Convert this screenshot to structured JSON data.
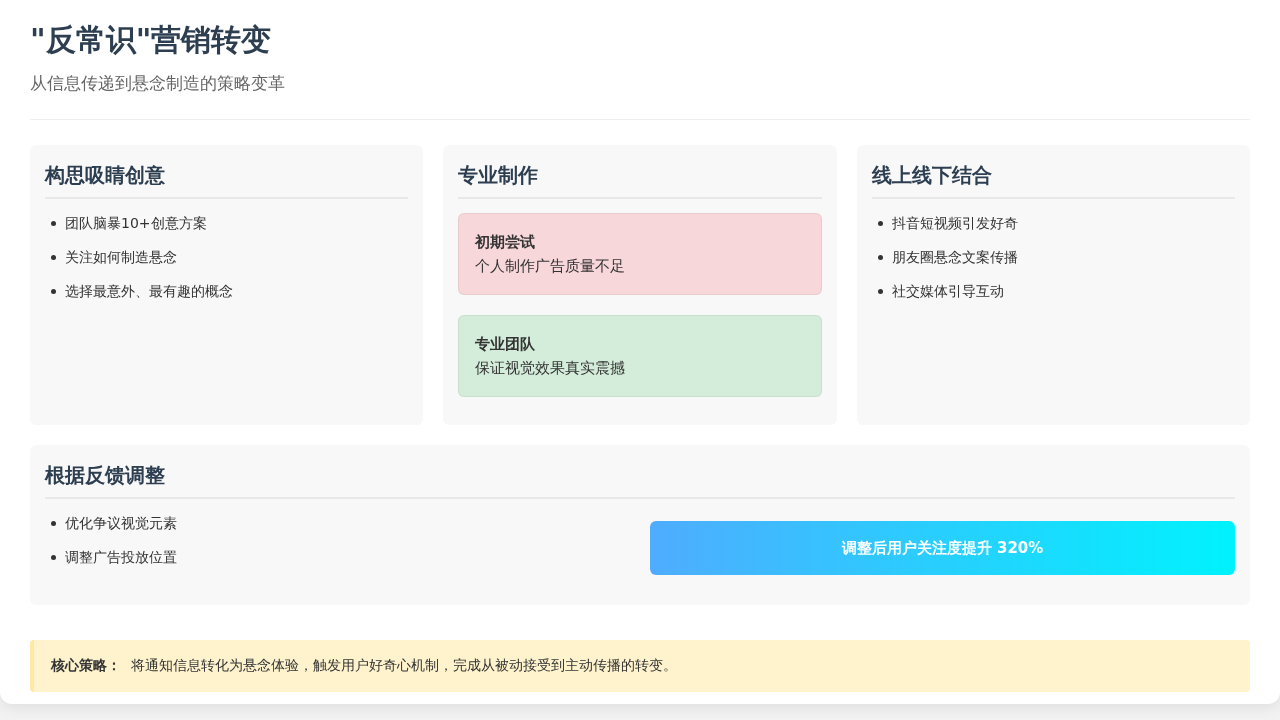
{
  "header": {
    "title": "\"反常识\"营销转变",
    "subtitle": "从信息传递到悬念制造的策略变革"
  },
  "panels": [
    {
      "kind": "list",
      "title": "构思吸睛创意",
      "items": [
        "团队脑暴10+创意方案",
        "关注如何制造悬念",
        "选择最意外、最有趣的概念"
      ]
    },
    {
      "kind": "stages",
      "title": "专业制作",
      "stages": [
        {
          "color": "#f8d7da",
          "title": "初期尝试",
          "text": "个人制作广告质量不足"
        },
        {
          "color": "#d4edda",
          "title": "专业团队",
          "text": "保证视觉效果真实震撼"
        }
      ]
    },
    {
      "kind": "list",
      "title": "线上线下结合",
      "items": [
        "抖音短视频引发好奇",
        "朋友圈悬念文案传播",
        "社交媒体引导互动"
      ]
    }
  ],
  "feedback": {
    "title": "根据反馈调整",
    "items": [
      "优化争议视觉元素",
      "调整广告投放位置"
    ],
    "result": "调整后用户关注度提升 320%"
  },
  "note": {
    "label": "核心策略：",
    "text": "将通知信息转化为悬念体验，触发用户好奇心机制，完成从被动接受到主动传播的转变。"
  }
}
